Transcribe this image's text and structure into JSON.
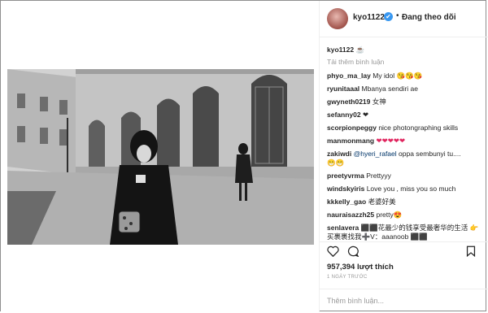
{
  "header": {
    "username": "kyo1122",
    "verified_mark": "✔",
    "separator": "•",
    "follow_status": "Đang theo dõi"
  },
  "caption": {
    "username": "kyo1122",
    "text": "☕"
  },
  "load_more": "Tải thêm bình luận",
  "comments": [
    {
      "user": "phyo_ma_lay",
      "text": "My idol 😘😘😘"
    },
    {
      "user": "ryunitaaal",
      "text": "Mbanya sendiri ae"
    },
    {
      "user": "gwyneth0219",
      "text": "女神"
    },
    {
      "user": "sefanny02",
      "text": "❤"
    },
    {
      "user": "scorpionpeggy",
      "text": "nice photongraphing skills"
    },
    {
      "user": "manmonmang",
      "text": "❤❤❤❤❤"
    },
    {
      "user": "zakiwdi",
      "mention": "@hyeri_rafael",
      "text": "oppa sembunyi tu....",
      "extra": "😁😁"
    },
    {
      "user": "preetyvrma",
      "text": "Prettyyy"
    },
    {
      "user": "windskyiris",
      "text": "Love you , miss you so much"
    },
    {
      "user": "kkkelly_gao",
      "text": "老婆好美"
    },
    {
      "user": "nauraisazzh25",
      "text": "pretty😍"
    },
    {
      "user": "senlavera",
      "text": "⬛⬛花最少的钱享受最奢华的生活 👉",
      "extra": "买裹裹找我➕V：aaanoob ⬛⬛"
    }
  ],
  "actions": {
    "like_icon": "heart-icon",
    "comment_icon": "comment-icon",
    "save_icon": "bookmark-icon"
  },
  "likes": "957,394 lượt thích",
  "timestamp": "1 NGÀY TRƯỚC",
  "add_comment_placeholder": "Thêm bình luận..."
}
